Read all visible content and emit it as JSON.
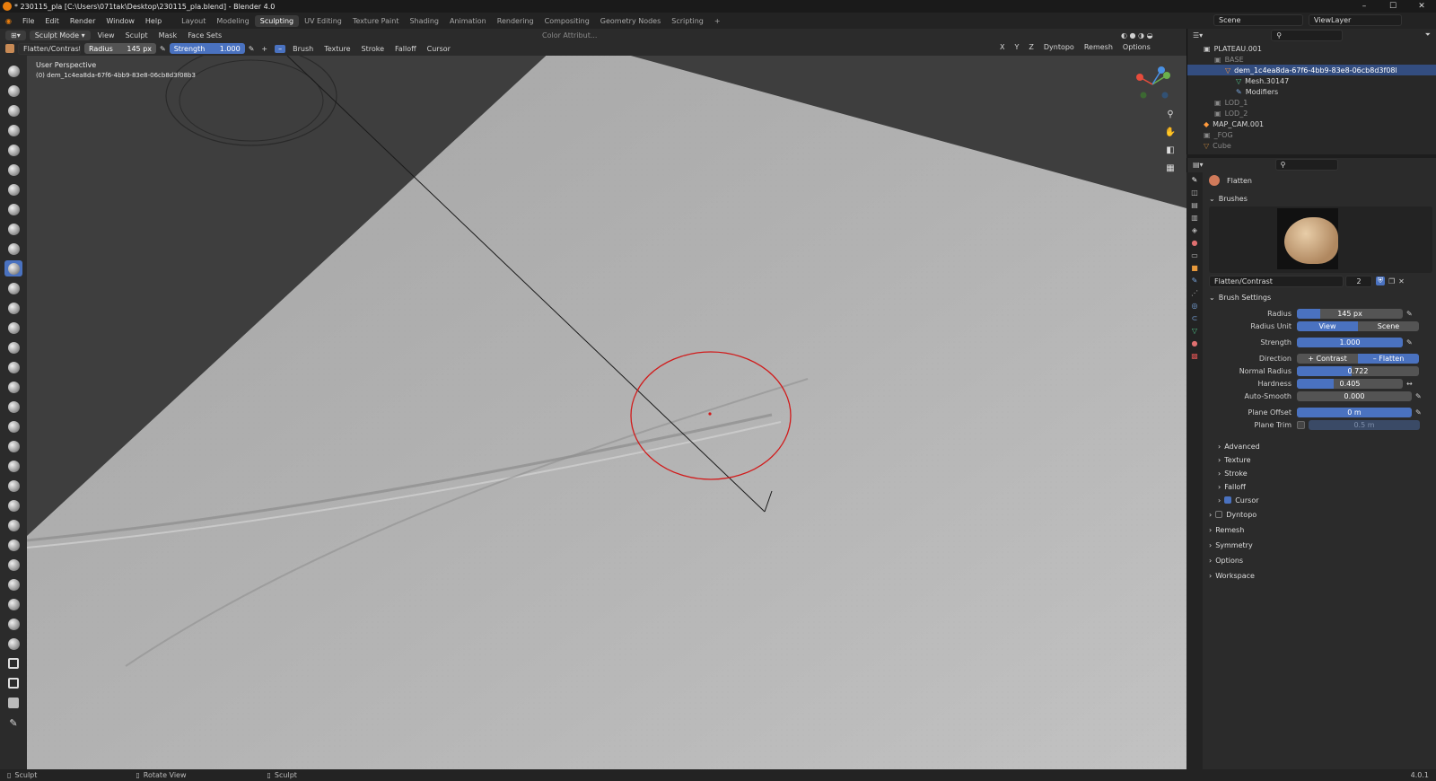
{
  "window": {
    "title": "* 230115_pla [C:\\Users\\071tak\\Desktop\\230115_pla.blend] - Blender 4.0",
    "minimize": "–",
    "maximize": "☐",
    "close": "✕"
  },
  "menu": [
    "File",
    "Edit",
    "Render",
    "Window",
    "Help"
  ],
  "workspaces": [
    "Layout",
    "Modeling",
    "Sculpting",
    "UV Editing",
    "Texture Paint",
    "Shading",
    "Animation",
    "Rendering",
    "Compositing",
    "Geometry Nodes",
    "Scripting"
  ],
  "active_workspace": "Sculpting",
  "scene": {
    "name": "Scene",
    "view_layer": "ViewLayer"
  },
  "header": {
    "mode": "Sculpt Mode",
    "menus": [
      "View",
      "Sculpt",
      "Mask",
      "Face Sets"
    ],
    "color_attribute": "Color Attribut...",
    "axes": [
      "X",
      "Y",
      "Z"
    ],
    "dyntopo": "Dyntopo",
    "remesh": "Remesh",
    "options": "Options"
  },
  "toolsettings": {
    "brush_name": "Flatten/Contrast",
    "radius_label": "Radius",
    "radius_value": "145 px",
    "strength_label": "Strength",
    "strength_value": "1.000",
    "plus": "+",
    "minus": "–",
    "dropdowns": [
      "Brush",
      "Texture",
      "Stroke",
      "Falloff",
      "Cursor"
    ]
  },
  "viewport": {
    "perspective": "User Perspective",
    "object": "(0) dem_1c4ea8da-67f6-4bb9-83e8-06cb8d3f08b3"
  },
  "outliner": {
    "rows": [
      {
        "label": "PLATEAU.001",
        "indent": 1,
        "state": "normal"
      },
      {
        "label": "BASE",
        "indent": 2,
        "state": "dim"
      },
      {
        "label": "dem_1c4ea8da-67f6-4bb9-83e8-06cb8d3f08l",
        "indent": 3,
        "state": "selected"
      },
      {
        "label": "Mesh.30147",
        "indent": 4,
        "state": "normal"
      },
      {
        "label": "Modifiers",
        "indent": 4,
        "state": "normal"
      },
      {
        "label": "LOD_1",
        "indent": 2,
        "state": "dim"
      },
      {
        "label": "LOD_2",
        "indent": 2,
        "state": "dim"
      },
      {
        "label": "MAP_CAM.001",
        "indent": 1,
        "state": "normal"
      },
      {
        "label": "_FOG",
        "indent": 1,
        "state": "dim"
      },
      {
        "label": "Cube",
        "indent": 1,
        "state": "dim"
      }
    ]
  },
  "properties": {
    "tool_name": "Flatten",
    "brushes_header": "Brushes",
    "brush_field": "Flatten/Contrast",
    "brush_users": "2",
    "brush_settings_header": "Brush Settings",
    "radius": {
      "label": "Radius",
      "value": "145 px",
      "fill": 0.22
    },
    "radius_unit": {
      "label": "Radius Unit",
      "view": "View",
      "scene": "Scene"
    },
    "strength": {
      "label": "Strength",
      "value": "1.000",
      "fill": 1.0
    },
    "direction": {
      "label": "Direction",
      "contrast": "Contrast",
      "flatten": "Flatten"
    },
    "normal_radius": {
      "label": "Normal Radius",
      "value": "0.722",
      "fill": 0.45
    },
    "hardness": {
      "label": "Hardness",
      "value": "0.405",
      "fill": 0.35
    },
    "auto_smooth": {
      "label": "Auto-Smooth",
      "value": "0.000",
      "fill": 0.0
    },
    "plane_offset": {
      "label": "Plane Offset",
      "value": "0 m",
      "fill": 1.0
    },
    "plane_trim": {
      "label": "Plane Trim",
      "value": "0.5 m"
    },
    "subpanels": [
      "Advanced",
      "Texture",
      "Stroke",
      "Falloff",
      "Cursor"
    ],
    "panels": [
      "Dyntopo",
      "Remesh",
      "Symmetry",
      "Options",
      "Workspace"
    ]
  },
  "status": {
    "left": "Sculpt",
    "middle": "Rotate View",
    "right": "Sculpt",
    "version": "4.0.1"
  },
  "colors": {
    "accent": "#4a72c0",
    "brush_cursor": "#d11a1a"
  }
}
